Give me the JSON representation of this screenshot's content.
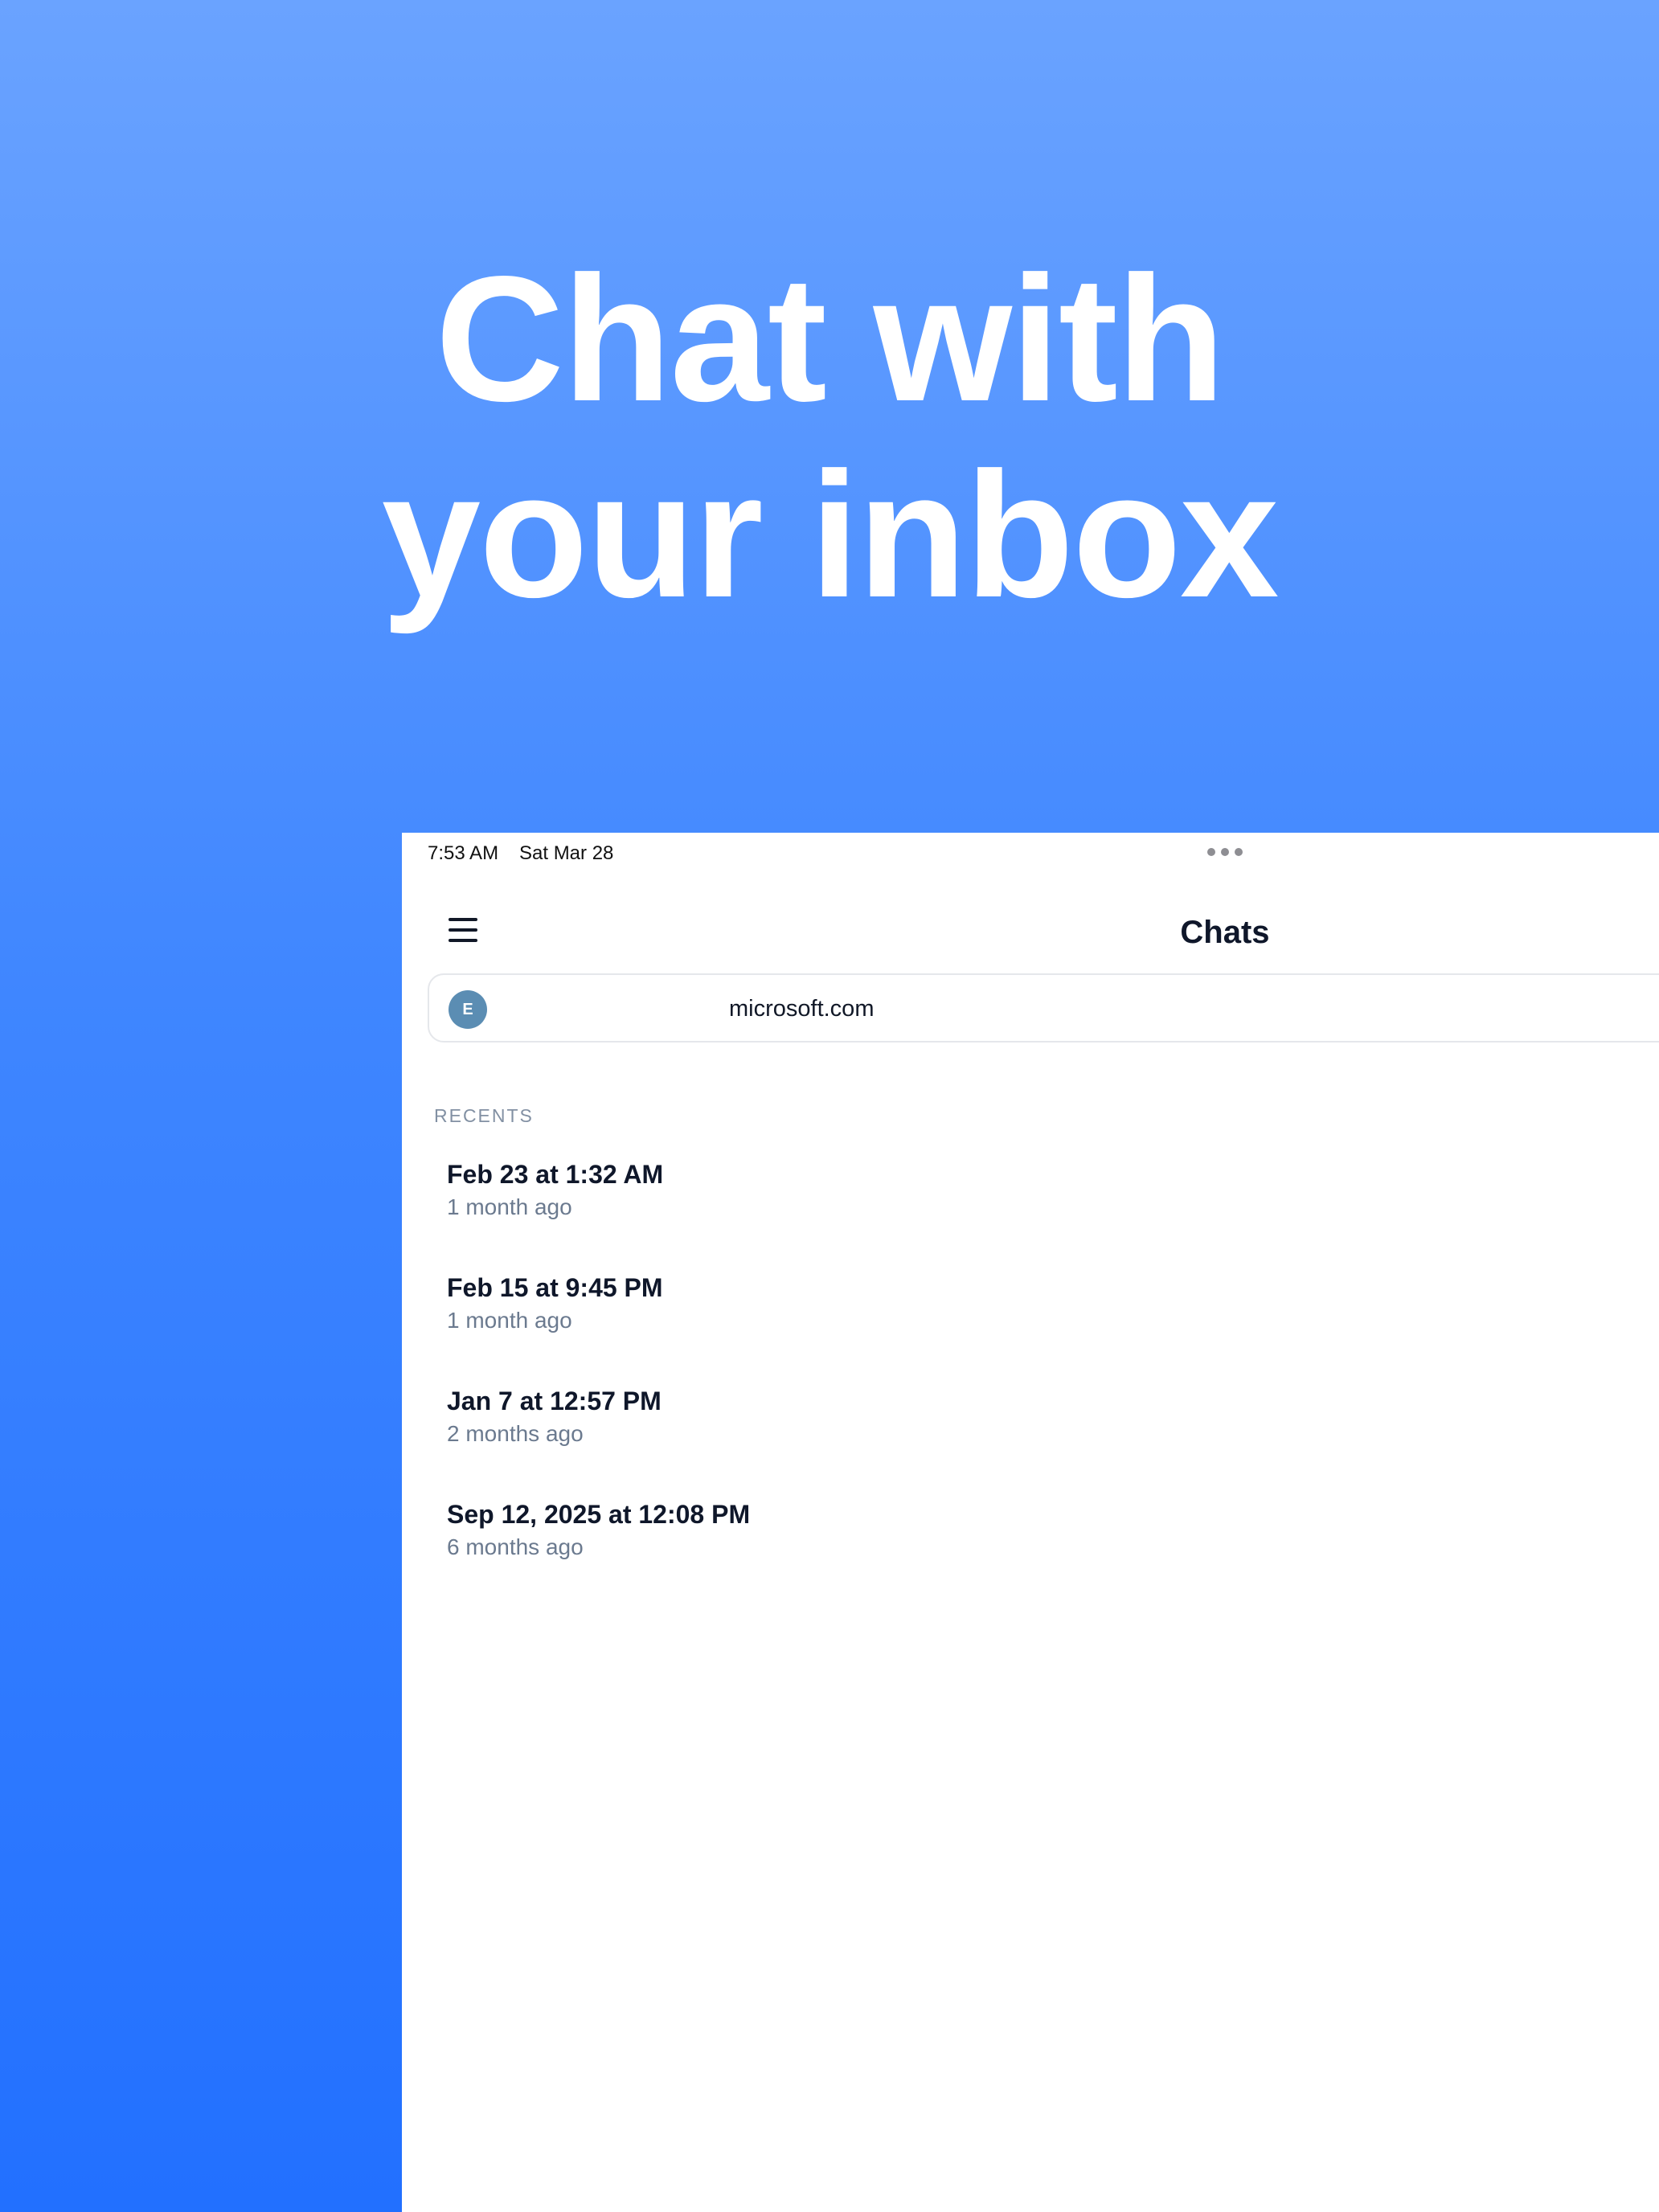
{
  "headline": {
    "line1": "Chat with",
    "line2": "your inbox"
  },
  "status_bar": {
    "time": "7:53 AM",
    "date": "Sat Mar 28",
    "multitasking_icon": "ellipsis-dots"
  },
  "nav": {
    "menu_icon": "hamburger-menu",
    "title": "Chats"
  },
  "account": {
    "avatar_initial": "E",
    "domain": "microsoft.com"
  },
  "recents": {
    "label": "RECENTS",
    "items": [
      {
        "title": "Feb 23 at 1:32 AM",
        "subtitle": "1 month ago"
      },
      {
        "title": "Feb 15 at 9:45 PM",
        "subtitle": "1 month ago"
      },
      {
        "title": "Jan 7 at 12:57 PM",
        "subtitle": "2 months ago"
      },
      {
        "title": "Sep 12, 2025 at 12:08 PM",
        "subtitle": "6 months ago"
      }
    ]
  },
  "colors": {
    "gradient_top": "#6aa3ff",
    "gradient_bottom": "#2270ff",
    "avatar": "#5b8db3",
    "title_text": "#0f172a",
    "secondary_text": "#6b7a8f"
  }
}
